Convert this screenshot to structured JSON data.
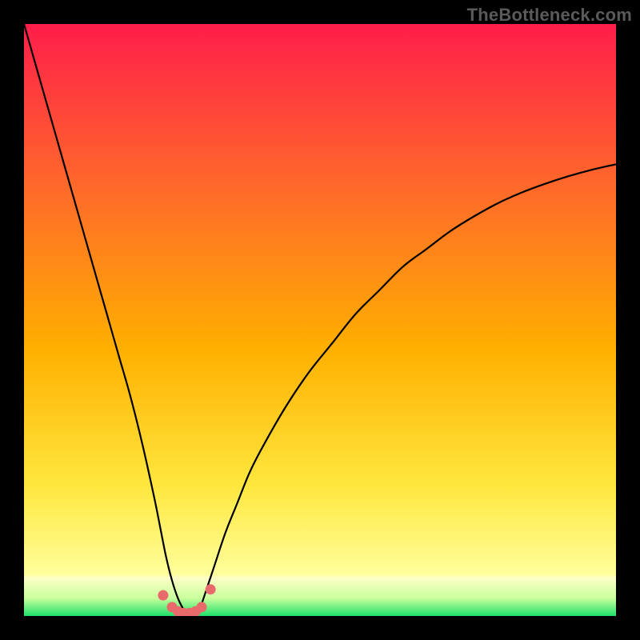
{
  "watermark": "TheBottleneck.com",
  "colors": {
    "bg_black": "#000000",
    "grad_top": "#ff1e4a",
    "grad_mid1": "#ff6a2a",
    "grad_mid2": "#ffb000",
    "grad_yellow": "#ffe73e",
    "grad_lightyellow": "#ffff9c",
    "grad_green": "#1fe06a",
    "curve": "#000000",
    "marker": "#e96a6a"
  },
  "chart_data": {
    "type": "line",
    "title": "",
    "xlabel": "",
    "ylabel": "",
    "xlim": [
      0,
      100
    ],
    "ylim": [
      0,
      100
    ],
    "series": [
      {
        "name": "left-branch",
        "x": [
          0,
          2,
          4,
          6,
          8,
          10,
          12,
          14,
          16,
          18,
          20,
          22,
          23,
          24,
          25,
          26,
          27
        ],
        "y": [
          100,
          93,
          86,
          79,
          72,
          65,
          58,
          51,
          44,
          37,
          29,
          20,
          15,
          10,
          6,
          3,
          1
        ]
      },
      {
        "name": "right-branch",
        "x": [
          30,
          32,
          34,
          36,
          38,
          40,
          44,
          48,
          52,
          56,
          60,
          64,
          68,
          72,
          76,
          80,
          84,
          88,
          92,
          96,
          100
        ],
        "y": [
          2,
          8,
          14,
          19,
          24,
          28,
          35,
          41,
          46,
          51,
          55,
          59,
          62,
          65,
          67.5,
          69.7,
          71.5,
          73,
          74.3,
          75.4,
          76.3
        ]
      }
    ],
    "markers": {
      "name": "optimum-points",
      "x": [
        23.5,
        25,
        26,
        27,
        28,
        29,
        30,
        31.5
      ],
      "y": [
        3.5,
        1.5,
        0.8,
        0.5,
        0.5,
        0.8,
        1.5,
        4.5
      ]
    }
  }
}
